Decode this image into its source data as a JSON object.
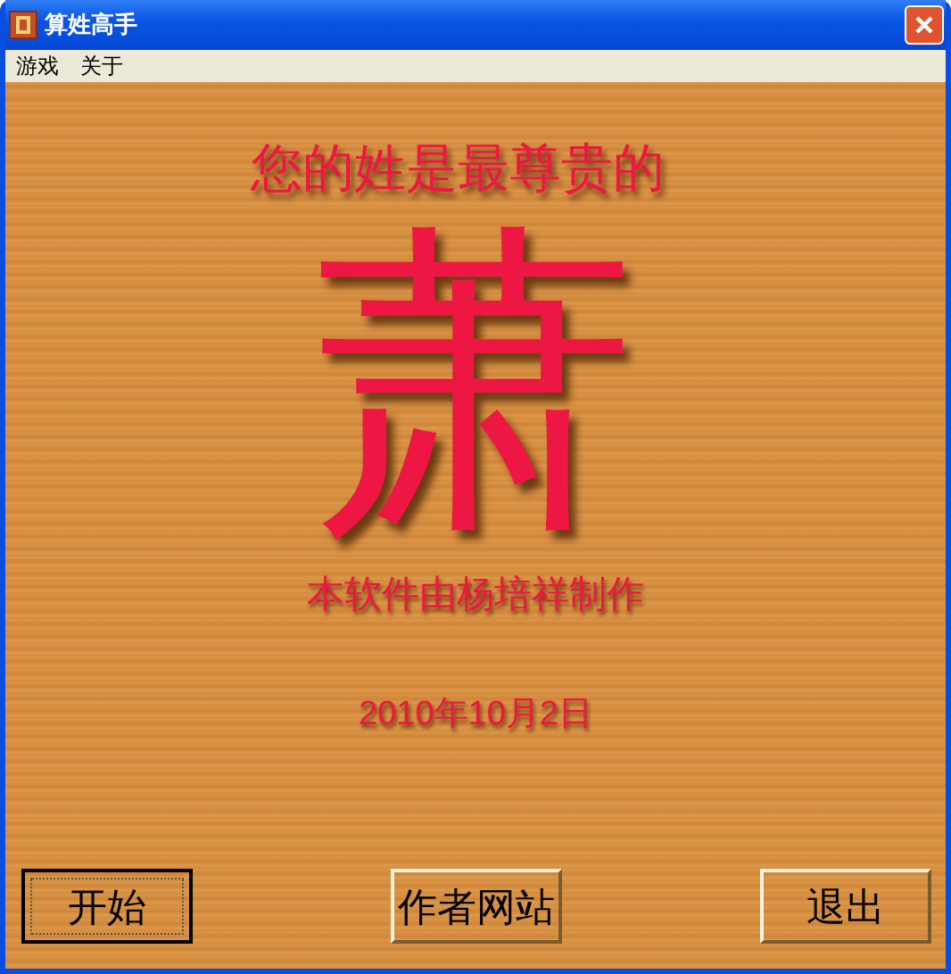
{
  "window": {
    "title": "算姓高手"
  },
  "menu": [
    "游戏",
    "关于"
  ],
  "headline": "您的姓是最尊贵的",
  "surname": "萧",
  "credit": "本软件由杨培祥制作",
  "date": "2010年10月2日",
  "buttons": [
    {
      "label": "开始",
      "focused": true
    },
    {
      "label": "作者网站",
      "focused": false
    },
    {
      "label": "退出",
      "focused": false
    }
  ]
}
